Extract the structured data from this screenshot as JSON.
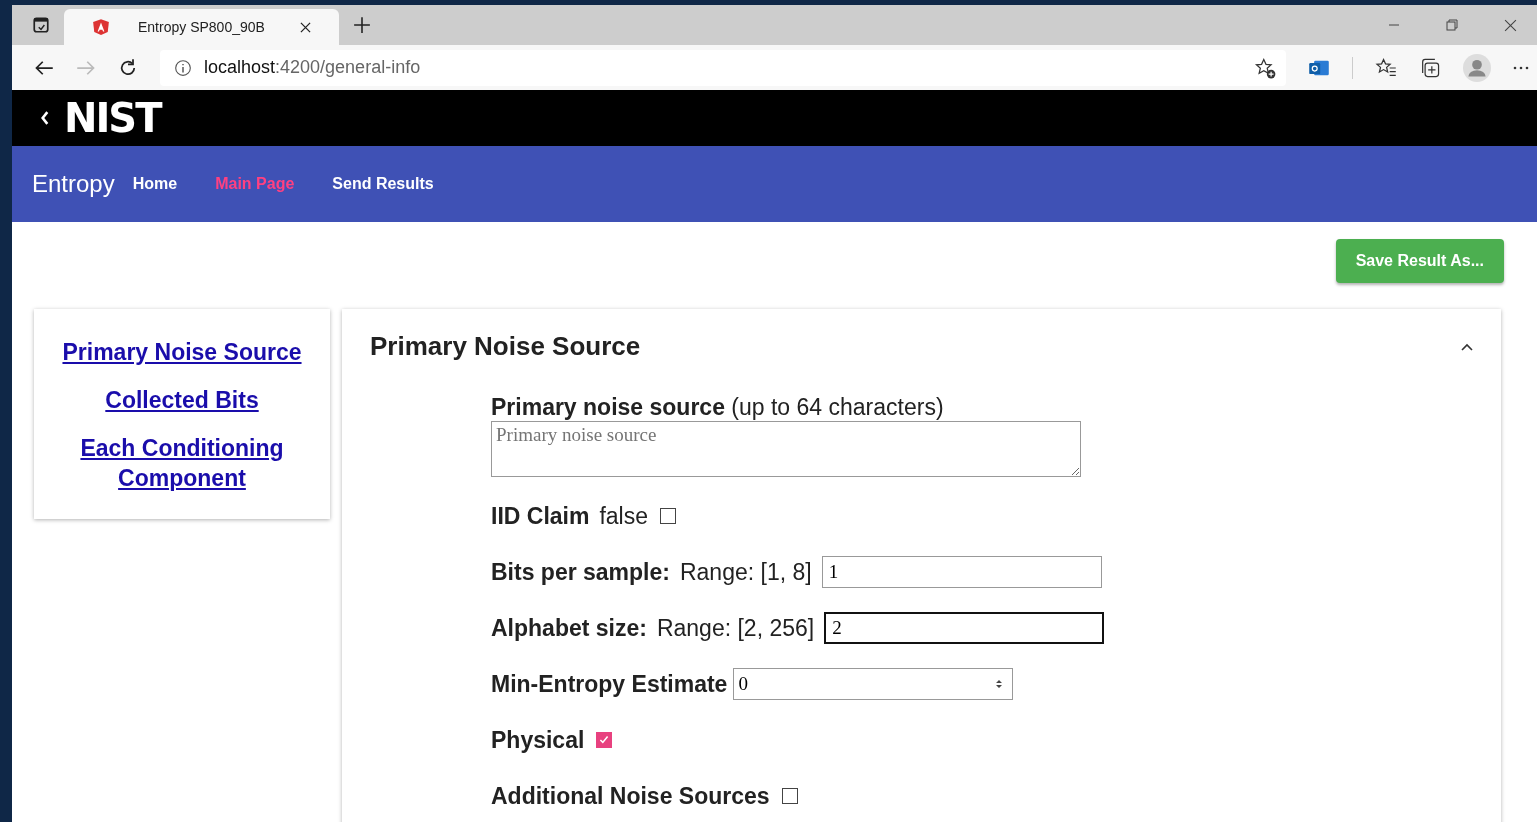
{
  "browser": {
    "tab_title": "Entropy SP800_90B",
    "address_host": "localhost",
    "address_path": ":4200/general-info"
  },
  "site": {
    "logo": "NIST",
    "brand": "Entropy",
    "nav": [
      {
        "label": "Home",
        "selected": false
      },
      {
        "label": "Main Page",
        "selected": true
      },
      {
        "label": "Send Results",
        "selected": false
      }
    ],
    "save_button": "Save Result As..."
  },
  "sidebar": {
    "links": [
      "Primary Noise Source",
      "Collected Bits",
      "Each Conditioning Component"
    ]
  },
  "panel": {
    "title": "Primary Noise Source",
    "expanded": true,
    "fields": [
      {
        "kind": "textarea",
        "label": "Primary noise source",
        "hint": "(up to 64 characters)",
        "placeholder": "Primary noise source"
      },
      {
        "kind": "checkbox",
        "label": "IID Claim",
        "value_text": "false",
        "checked": false
      },
      {
        "kind": "text",
        "label": "Bits per sample:",
        "range": "Range: [1, 8]",
        "value": "1",
        "focused": false
      },
      {
        "kind": "text",
        "label": "Alphabet size:",
        "range": "Range: [2, 256]",
        "value": "2",
        "focused": true
      },
      {
        "kind": "number",
        "label": "Min-Entropy Estimate",
        "value": "0"
      },
      {
        "kind": "checkbox",
        "label": "Physical",
        "checked": true
      },
      {
        "kind": "checkbox",
        "label": "Additional Noise Sources",
        "checked": false
      }
    ]
  }
}
